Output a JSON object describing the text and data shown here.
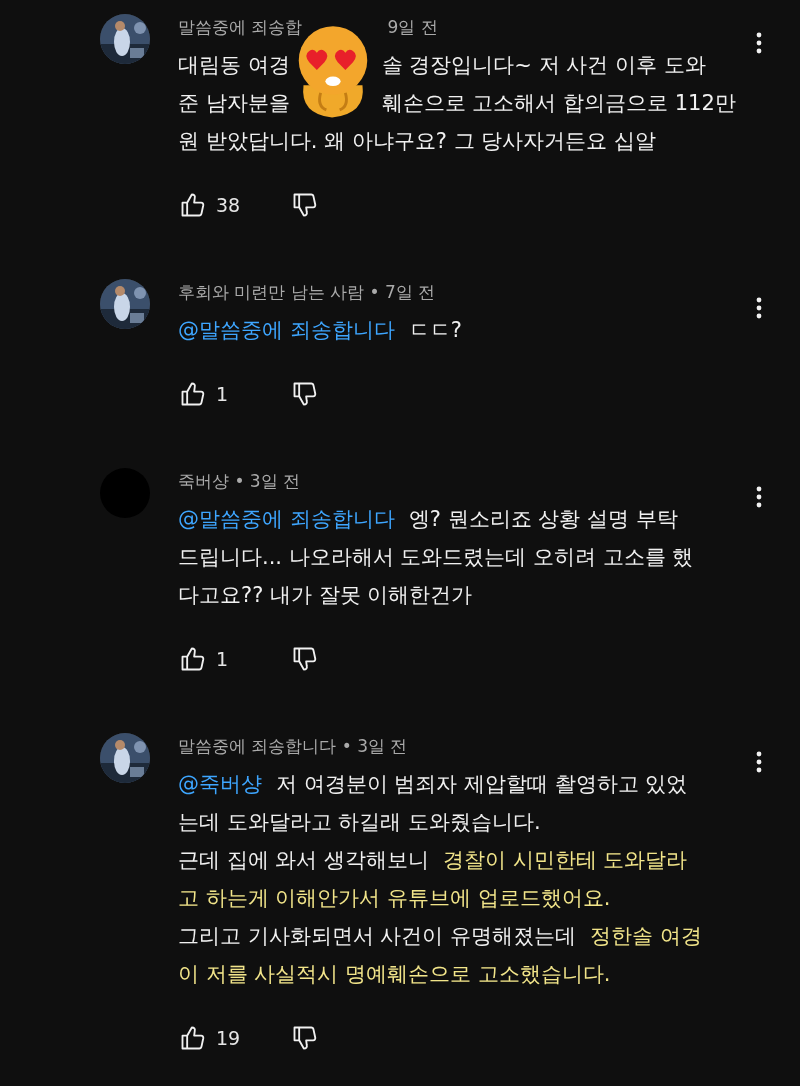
{
  "comments": [
    {
      "avatar": {
        "kind": "picture"
      },
      "author": [
        {
          "text": "말씀중에 죄송합"
        },
        {
          "text": "9일 전"
        }
      ],
      "sticker": true,
      "lines": [
        [
          {
            "text": "대림동 여경",
            "kind": "plain"
          },
          {
            "text": "솔 경장입니다~ 저 사건 이후 도와",
            "kind": "plain"
          }
        ],
        [
          {
            "text": "준 남자분을",
            "kind": "plain"
          },
          {
            "text": "훼손으로 고소해서 합의금으로 112만",
            "kind": "plain"
          }
        ],
        [
          {
            "text": "원 받았답니다. 왜 아냐구요? 그 당사자거든요 십알",
            "kind": "plain"
          }
        ]
      ],
      "likes": "38"
    },
    {
      "avatar": {
        "kind": "picture"
      },
      "author": [
        {
          "text": "후회와 미련만 남는 사람 • 7일 전"
        }
      ],
      "lines": [
        [
          {
            "text": "@말씀중에 죄송합니다",
            "kind": "mention"
          },
          {
            "text": "ㄷㄷ?",
            "kind": "plain"
          }
        ]
      ],
      "likes": "1"
    },
    {
      "avatar": {
        "kind": "blank"
      },
      "author": [
        {
          "text": "죽버샹 • 3일 전"
        }
      ],
      "lines": [
        [
          {
            "text": "@말씀중에 죄송합니다",
            "kind": "mention"
          },
          {
            "text": "엥? 뭔소리죠 상황 설명 부탁",
            "kind": "plain"
          }
        ],
        [
          {
            "text": "드립니다... 나오라해서 도와드렸는데 오히려 고소를 했",
            "kind": "plain"
          }
        ],
        [
          {
            "text": "다고요?? 내가 잘못 이해한건가",
            "kind": "plain"
          }
        ]
      ],
      "likes": "1"
    },
    {
      "avatar": {
        "kind": "picture"
      },
      "author": [
        {
          "text": "말씀중에 죄송합니다 • 3일 전"
        }
      ],
      "lines": [
        [
          {
            "text": "@죽버샹",
            "kind": "mention"
          },
          {
            "text": "저 여경분이 범죄자 제압할때 촬영하고 있었",
            "kind": "plain"
          }
        ],
        [
          {
            "text": "는데 도와달라고 하길래 도와줬습니다.",
            "kind": "plain"
          }
        ],
        [
          {
            "text": "근데 집에 와서 생각해보니",
            "kind": "plain"
          },
          {
            "text": "경찰이 시민한테 도와달라",
            "kind": "highlight"
          }
        ],
        [
          {
            "text": "고 하는게 이해안가서 유튜브에 업로드했어요.",
            "kind": "highlight"
          }
        ],
        [
          {
            "text": "그리고 기사화되면서 사건이 유명해졌는데",
            "kind": "plain"
          },
          {
            "text": "정한솔 여경",
            "kind": "highlight"
          }
        ],
        [
          {
            "text": "이 저를 사실적시 명예훼손으로 고소했습니다.",
            "kind": "highlight"
          }
        ]
      ],
      "likes": "19"
    }
  ]
}
